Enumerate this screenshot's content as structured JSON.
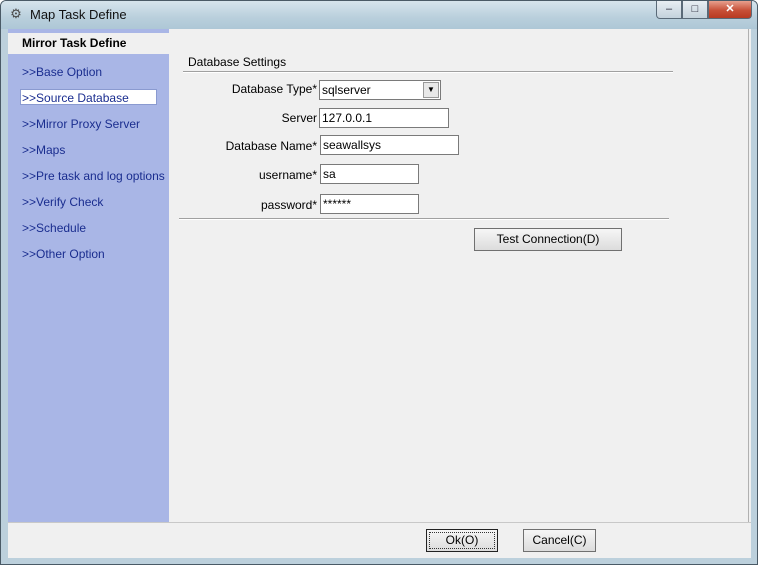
{
  "window": {
    "title": "Map Task Define",
    "minimize_label": "–",
    "maximize_label": "□",
    "close_label": "✕"
  },
  "sidebar": {
    "title": "Mirror Task Define",
    "items": [
      {
        "label": ">>Base Option"
      },
      {
        "label": ">>Source Database",
        "active": true
      },
      {
        "label": ">>Mirror Proxy Server"
      },
      {
        "label": ">>Maps"
      },
      {
        "label": ">>Pre task and log options"
      },
      {
        "label": ">>Verify Check"
      },
      {
        "label": ">>Schedule"
      },
      {
        "label": ">>Other Option"
      }
    ]
  },
  "settings": {
    "group_title": "Database Settings",
    "database_type": {
      "label": "Database Type*",
      "value": "sqlserver"
    },
    "server": {
      "label": "Server",
      "value": "127.0.0.1"
    },
    "database_name": {
      "label": "Database Name*",
      "value": "seawallsys"
    },
    "username": {
      "label": "username*",
      "value": "sa"
    },
    "password": {
      "label": "password*",
      "value": "******"
    },
    "test_connection_label": "Test Connection(D)"
  },
  "footer": {
    "ok_label": "Ok(O)",
    "cancel_label": "Cancel(C)"
  }
}
